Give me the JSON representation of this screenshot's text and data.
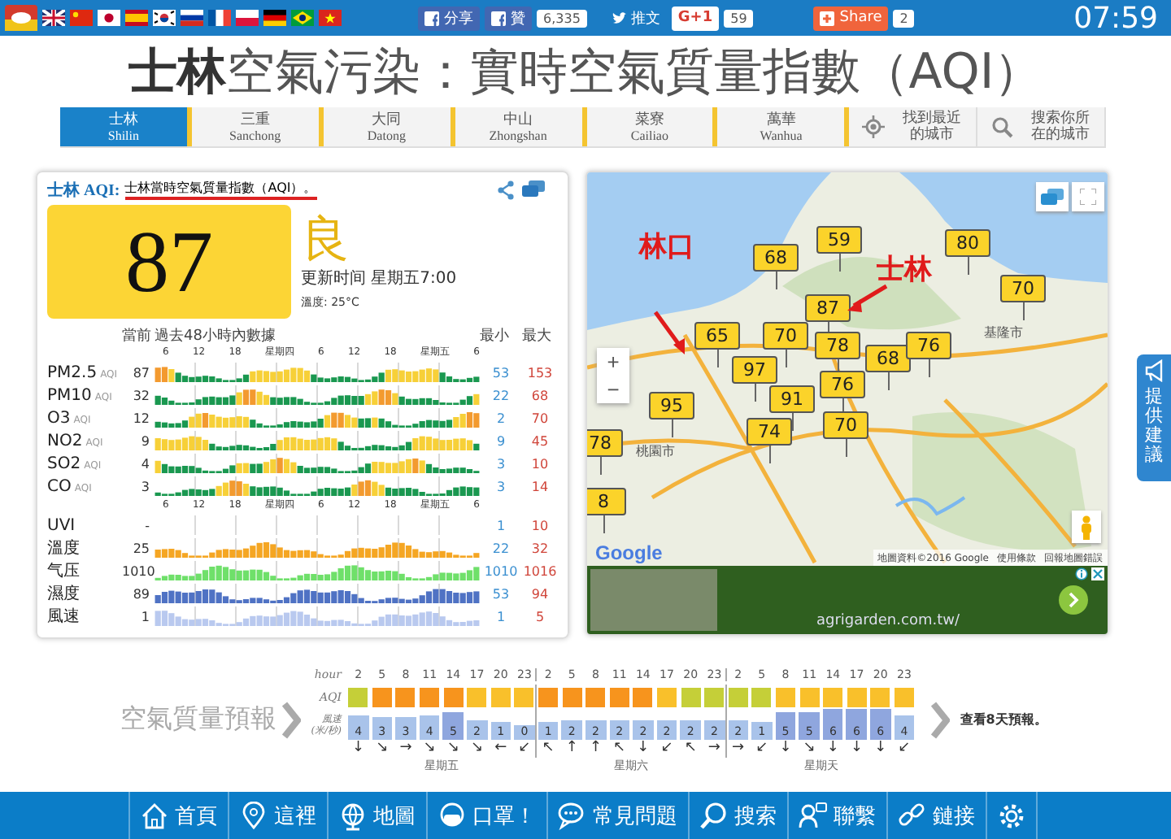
{
  "top_bar": {
    "share_buttons": [
      {
        "kind": "facebook",
        "label": "分享"
      },
      {
        "kind": "facebook",
        "label": "贊",
        "count": "6,335"
      },
      {
        "kind": "twitter",
        "label": "推文"
      },
      {
        "kind": "gplus",
        "label": "G+1",
        "count": "59"
      },
      {
        "kind": "share",
        "label": "Share",
        "count": "2"
      }
    ],
    "clock": "07:59"
  },
  "title": "**士林**空氣污染：實時空氣質量指數（AQI）",
  "city_tabs": [
    {
      "kind": "city",
      "label": "士林",
      "sublabel": "Shilin",
      "selected": true
    },
    {
      "kind": "city",
      "label": "三重",
      "sublabel": "Sanchong",
      "selected": false
    },
    {
      "kind": "city",
      "label": "大同",
      "sublabel": "Datong",
      "selected": false
    },
    {
      "kind": "city",
      "label": "中山",
      "sublabel": "Zhongshan",
      "selected": false
    },
    {
      "kind": "city",
      "label": "菜寮",
      "sublabel": "Cailiao",
      "selected": false
    },
    {
      "kind": "city",
      "label": "萬華",
      "sublabel": "Wanhua",
      "selected": false
    },
    {
      "kind": "locate",
      "label": "找到最近的城市",
      "selected": false
    },
    {
      "kind": "search",
      "label": "搜索你所在的城市",
      "selected": false
    }
  ],
  "aqi_card": {
    "station": "士林 AQI:",
    "description": "士林當時空氣質量指數（AQI）。",
    "aqi": "87",
    "level_label": "良",
    "updated": "更新时间 星期五7:00",
    "temperature": "溫度: 25°C",
    "current_heading": "當前",
    "history_heading": "過去48小時內數據",
    "min_heading": "最小",
    "max_heading": "最大",
    "rows": [
      {
        "kind": "axis",
        "labels": [
          "6",
          "12",
          "18",
          "星期四",
          "6",
          "12",
          "18",
          "星期五",
          "6"
        ]
      },
      {
        "kind": "pollutant",
        "name": "PM2.5",
        "unit": "AQI",
        "current": "87",
        "min": "53",
        "max": "153"
      },
      {
        "kind": "pollutant",
        "name": "PM10",
        "unit": "AQI",
        "current": "32",
        "min": "22",
        "max": "68"
      },
      {
        "kind": "pollutant",
        "name": "O3",
        "unit": "AQI",
        "current": "12",
        "min": "2",
        "max": "70"
      },
      {
        "kind": "pollutant",
        "name": "NO2",
        "unit": "AQI",
        "current": "9",
        "min": "9",
        "max": "45"
      },
      {
        "kind": "pollutant",
        "name": "SO2",
        "unit": "AQI",
        "current": "4",
        "min": "3",
        "max": "10"
      },
      {
        "kind": "pollutant",
        "name": "CO",
        "unit": "AQI",
        "current": "3",
        "min": "3",
        "max": "14"
      },
      {
        "kind": "axis",
        "labels": [
          "6",
          "12",
          "18",
          "星期四",
          "6",
          "12",
          "18",
          "星期五",
          "6"
        ]
      },
      {
        "kind": "blank",
        "name": "UVI",
        "current": "-",
        "min": "1",
        "max": "10"
      },
      {
        "kind": "weather",
        "name": "溫度",
        "current": "25",
        "min": "22",
        "max": "32",
        "color": "#f5a623"
      },
      {
        "kind": "weather",
        "name": "气压",
        "current": "1010",
        "min": "1010",
        "max": "1016",
        "color": "#6fe06a"
      },
      {
        "kind": "weather",
        "name": "濕度",
        "current": "89",
        "min": "53",
        "max": "94",
        "color": "#4f72c4"
      },
      {
        "kind": "weather",
        "name": "風速",
        "current": "1",
        "min": "1",
        "max": "5",
        "color": "#b9c9ef"
      }
    ]
  },
  "map": {
    "pins": [
      {
        "value": "68"
      },
      {
        "value": "59"
      },
      {
        "value": "80"
      },
      {
        "value": "70"
      },
      {
        "value": "87"
      },
      {
        "value": "65"
      },
      {
        "value": "70"
      },
      {
        "value": "78"
      },
      {
        "value": "68"
      },
      {
        "value": "76"
      },
      {
        "value": "97"
      },
      {
        "value": "91"
      },
      {
        "value": "76"
      },
      {
        "value": "74"
      },
      {
        "value": "70"
      },
      {
        "value": "95"
      },
      {
        "value": "78"
      },
      {
        "value": "8"
      }
    ],
    "annotations": [
      {
        "label": "林口"
      },
      {
        "label": "士林"
      }
    ],
    "city_labels": [
      "基隆市",
      "桃園市"
    ],
    "zoom_in": "+",
    "zoom_out": "−",
    "logo": "Google",
    "attribution": [
      "地圖資料©2016 Google",
      "使用條款",
      "回報地圖錯誤"
    ],
    "ad": {
      "url": "agrigarden.com.tw/"
    }
  },
  "side_tab": {
    "label": "提供建議"
  },
  "forecast": {
    "title": "空氣質量預報",
    "hour_label": "hour",
    "aqi_label": "AQI",
    "wind_label": "風速 (米/秒)",
    "hours": [
      "2",
      "5",
      "8",
      "11",
      "14",
      "17",
      "20",
      "23",
      "2",
      "5",
      "8",
      "11",
      "14",
      "17",
      "20",
      "23",
      "2",
      "5",
      "8",
      "11",
      "14",
      "17",
      "20",
      "23"
    ],
    "aqi": [
      {
        "color": "#c5cf38"
      },
      {
        "color": "#f7941d"
      },
      {
        "color": "#f7941d"
      },
      {
        "color": "#f7941d"
      },
      {
        "color": "#f7941d"
      },
      {
        "color": "#f9c02b"
      },
      {
        "color": "#f9c02b"
      },
      {
        "color": "#f9c02b"
      },
      {
        "color": "#f7941d"
      },
      {
        "color": "#f7941d"
      },
      {
        "color": "#f7941d"
      },
      {
        "color": "#f7941d"
      },
      {
        "color": "#f7941d"
      },
      {
        "color": "#f9c02b"
      },
      {
        "color": "#c5cf38"
      },
      {
        "color": "#c5cf38"
      },
      {
        "color": "#c5cf38"
      },
      {
        "color": "#c5cf38"
      },
      {
        "color": "#f9c02b"
      },
      {
        "color": "#f9c02b"
      },
      {
        "color": "#f9c02b"
      },
      {
        "color": "#f9c02b"
      },
      {
        "color": "#f9c02b"
      },
      {
        "color": "#f9c02b"
      }
    ],
    "wind": [
      {
        "speed": "4",
        "direction": "↓"
      },
      {
        "speed": "3",
        "direction": "↘"
      },
      {
        "speed": "3",
        "direction": "→"
      },
      {
        "speed": "4",
        "direction": "↘"
      },
      {
        "speed": "5",
        "direction": "↘"
      },
      {
        "speed": "2",
        "direction": "↘"
      },
      {
        "speed": "1",
        "direction": "←"
      },
      {
        "speed": "0",
        "direction": "↙"
      },
      {
        "speed": "1",
        "direction": "↖"
      },
      {
        "speed": "2",
        "direction": "↑"
      },
      {
        "speed": "2",
        "direction": "↑"
      },
      {
        "speed": "2",
        "direction": "↖"
      },
      {
        "speed": "2",
        "direction": "↓"
      },
      {
        "speed": "2",
        "direction": "↙"
      },
      {
        "speed": "2",
        "direction": "↖"
      },
      {
        "speed": "2",
        "direction": "→"
      },
      {
        "speed": "2",
        "direction": "→"
      },
      {
        "speed": "1",
        "direction": "↙"
      },
      {
        "speed": "5",
        "direction": "↓"
      },
      {
        "speed": "5",
        "direction": "↘"
      },
      {
        "speed": "6",
        "direction": "↓"
      },
      {
        "speed": "6",
        "direction": "↓"
      },
      {
        "speed": "6",
        "direction": "↓"
      },
      {
        "speed": "4",
        "direction": "↙"
      }
    ],
    "days": [
      "星期五",
      "星期六",
      "星期天"
    ],
    "more": "查看8天預報。"
  },
  "bottom_nav": {
    "items": [
      {
        "kind": "home",
        "label": "首頁"
      },
      {
        "kind": "pin",
        "label": "這裡"
      },
      {
        "kind": "globe",
        "label": "地圖"
      },
      {
        "kind": "mask",
        "label": "口罩！"
      },
      {
        "kind": "faq",
        "label": "常見問題"
      },
      {
        "kind": "search",
        "label": "搜索"
      },
      {
        "kind": "contact",
        "label": "聯繫"
      },
      {
        "kind": "link",
        "label": "鏈接"
      },
      {
        "kind": "settings"
      }
    ]
  }
}
